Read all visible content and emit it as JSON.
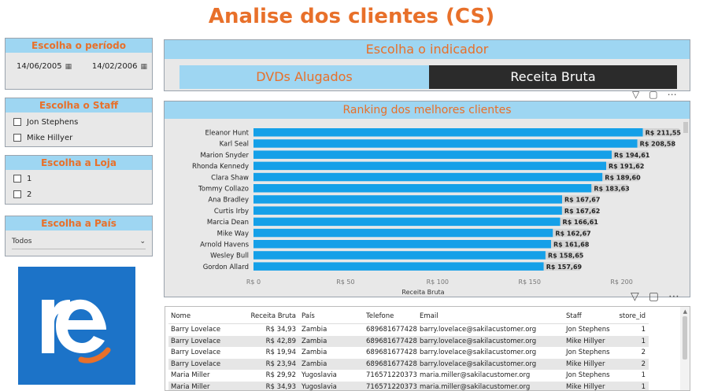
{
  "title": "Analise dos clientes (CS)",
  "periodo": {
    "header": "Escolha o período",
    "start": "14/06/2005",
    "end": "14/02/2006"
  },
  "staff": {
    "header": "Escolha o Staff",
    "options": [
      "Jon Stephens",
      "Mike Hillyer"
    ]
  },
  "loja": {
    "header": "Escolha a Loja",
    "options": [
      "1",
      "2"
    ]
  },
  "pais": {
    "header": "Escolha a País",
    "selected": "Todos"
  },
  "indicador": {
    "header": "Escolha o indicador",
    "option_a": "DVDs Alugados",
    "option_b": "Receita Bruta",
    "selected": "Receita Bruta"
  },
  "colors": {
    "accent": "#e8702a",
    "header_bg": "#9ed6f2",
    "bar": "#15a0e8",
    "logo_bg": "#1c73c8",
    "selected_btn": "#2b2b2b"
  },
  "chart_data": {
    "type": "bar",
    "orientation": "horizontal",
    "title": "Ranking dos melhores clientes",
    "xlabel": "Receita Bruta",
    "ylabel": "",
    "xlim": [
      0,
      210
    ],
    "xticks": [
      "R$ 0",
      "R$ 50",
      "R$ 100",
      "R$ 150",
      "R$ 200"
    ],
    "xtick_values": [
      0,
      50,
      100,
      150,
      200
    ],
    "categories": [
      "Eleanor Hunt",
      "Karl Seal",
      "Marion Snyder",
      "Rhonda Kennedy",
      "Clara Shaw",
      "Tommy Collazo",
      "Ana Bradley",
      "Curtis Irby",
      "Marcia Dean",
      "Mike Way",
      "Arnold Havens",
      "Wesley Bull",
      "Gordon Allard"
    ],
    "values": [
      211.55,
      208.58,
      194.61,
      191.62,
      189.6,
      183.63,
      167.67,
      167.62,
      166.61,
      162.67,
      161.68,
      158.65,
      157.69
    ],
    "labels": [
      "R$ 211,55",
      "R$ 208,58",
      "R$ 194,61",
      "R$ 191,62",
      "R$ 189,60",
      "R$ 183,63",
      "R$ 167,67",
      "R$ 167,62",
      "R$ 166,61",
      "R$ 162,67",
      "R$ 161,68",
      "R$ 158,65",
      "R$ 157,69"
    ]
  },
  "table": {
    "columns": [
      "Nome",
      "Receita Bruta",
      "País",
      "Telefone",
      "Email",
      "Staff",
      "store_id"
    ],
    "rows": [
      [
        "Barry Lovelace",
        "R$ 34,93",
        "Zambia",
        "689681677428",
        "barry.lovelace@sakilacustomer.org",
        "Jon Stephens",
        "1"
      ],
      [
        "Barry Lovelace",
        "R$ 42,89",
        "Zambia",
        "689681677428",
        "barry.lovelace@sakilacustomer.org",
        "Mike Hillyer",
        "1"
      ],
      [
        "Barry Lovelace",
        "R$ 19,94",
        "Zambia",
        "689681677428",
        "barry.lovelace@sakilacustomer.org",
        "Jon Stephens",
        "2"
      ],
      [
        "Barry Lovelace",
        "R$ 23,94",
        "Zambia",
        "689681677428",
        "barry.lovelace@sakilacustomer.org",
        "Mike Hillyer",
        "2"
      ],
      [
        "Maria Miller",
        "R$ 29,92",
        "Yugoslavia",
        "716571220373",
        "maria.miller@sakilacustomer.org",
        "Jon Stephens",
        "1"
      ],
      [
        "Maria Miller",
        "R$ 34,93",
        "Yugoslavia",
        "716571220373",
        "maria.miller@sakilacustomer.org",
        "Mike Hillyer",
        "1"
      ]
    ]
  }
}
